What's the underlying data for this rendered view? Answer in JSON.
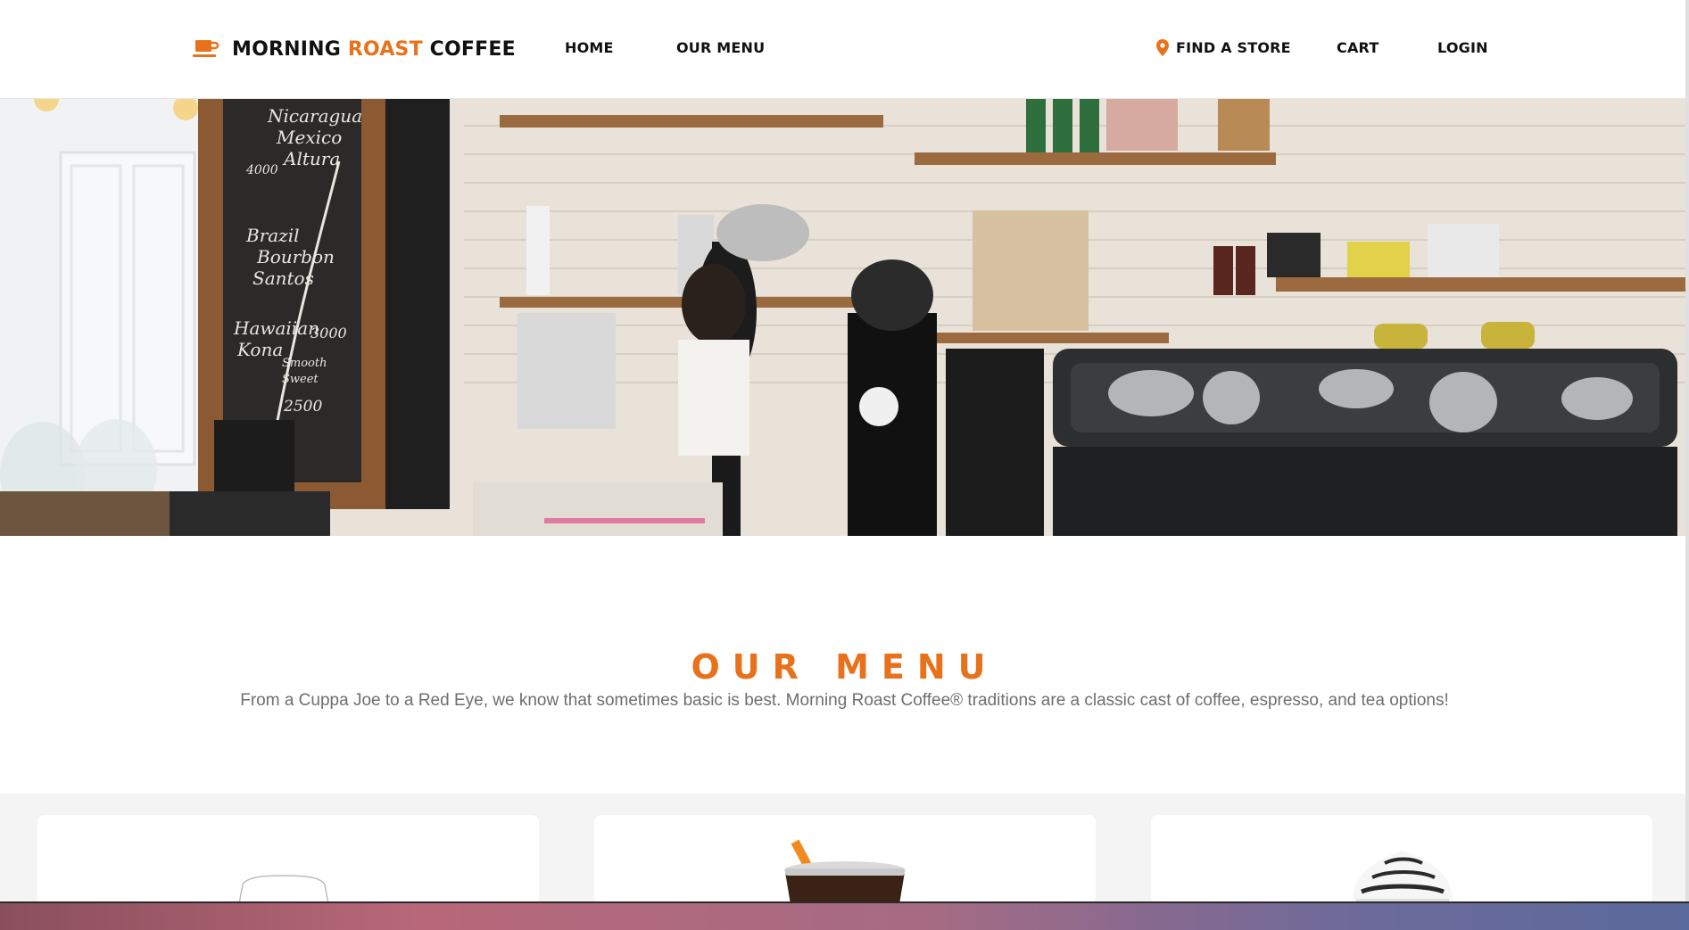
{
  "header": {
    "brand": {
      "part1": "MORNING ",
      "part2": "ROAST",
      "part3": " COFFEE"
    },
    "nav_left": [
      {
        "label": "HOME"
      },
      {
        "label": "OUR MENU"
      }
    ],
    "nav_right": [
      {
        "label": "FIND A STORE",
        "icon": "location-pin-icon"
      },
      {
        "label": "CART"
      },
      {
        "label": "LOGIN"
      }
    ]
  },
  "hero": {
    "image": "coffee-shop-counter-photo",
    "chalkboard_text": [
      "Nicaragua",
      "Mexico",
      "Altura",
      "Brazil",
      "Bourbon",
      "Santos",
      "Hawaiian",
      "Kona",
      "2500",
      "3000"
    ]
  },
  "menu": {
    "title": "OUR MENU",
    "description": "From a Cuppa Joe to a Red Eye, we know that sometimes basic is best. Morning Roast Coffee® traditions are a classic cast of coffee, espresso, and tea options!"
  },
  "cards": [
    {
      "image": "hot-coffee-cup"
    },
    {
      "image": "iced-coffee-cup"
    },
    {
      "image": "whipped-cream-drink"
    }
  ],
  "colors": {
    "accent": "#e8711c",
    "text_dark": "#111111",
    "text_muted": "#6e6e6e",
    "cards_bg": "#f4f4f4"
  }
}
